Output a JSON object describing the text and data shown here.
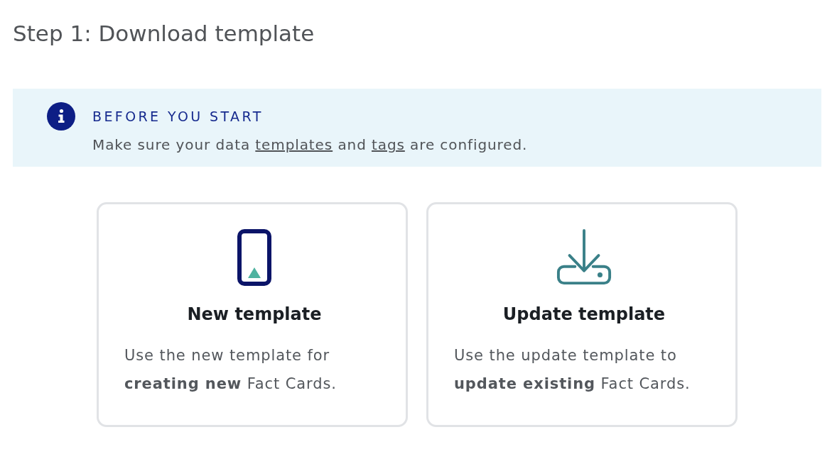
{
  "heading": "Step 1: Download template",
  "notice": {
    "title": "BEFORE YOU START",
    "message": [
      {
        "kind": "text",
        "text": "Make sure your data "
      },
      {
        "kind": "link",
        "text": "templates"
      },
      {
        "kind": "text",
        "text": " and "
      },
      {
        "kind": "link",
        "text": "tags"
      },
      {
        "kind": "text",
        "text": " are configured."
      }
    ]
  },
  "cards": [
    {
      "kind": "new",
      "title": "New template",
      "description": "Use the new template for **creating new** Fact Cards."
    },
    {
      "kind": "update",
      "title": "Update template",
      "description": "Use the update template to **update existing** Fact Cards."
    }
  ]
}
